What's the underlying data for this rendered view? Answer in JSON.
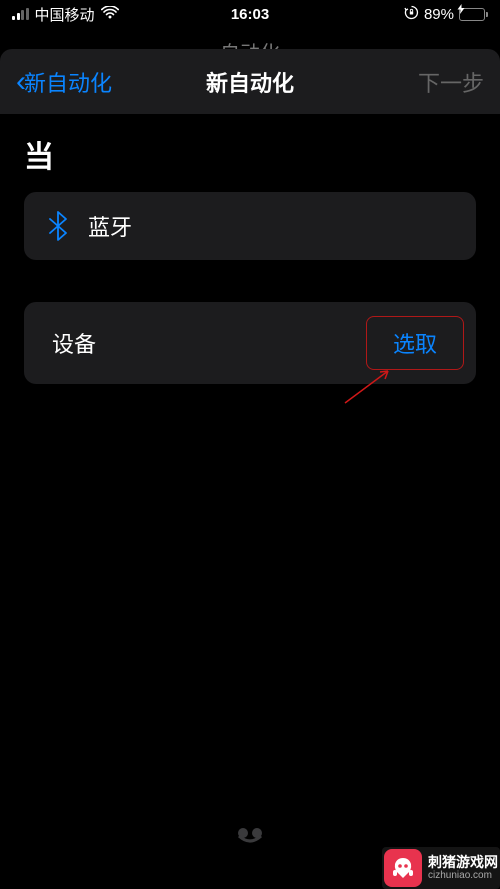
{
  "statusBar": {
    "carrier": "中国移动",
    "time": "16:03",
    "battery": "89%"
  },
  "bgTitle": "自动化",
  "nav": {
    "back": "新自动化",
    "title": "新自动化",
    "next": "下一步"
  },
  "sectionHeader": "当",
  "bluetooth": {
    "label": "蓝牙"
  },
  "device": {
    "label": "设备",
    "select": "选取"
  },
  "watermark": {
    "title": "刺猪游戏网",
    "url": "cizhuniao.com"
  }
}
